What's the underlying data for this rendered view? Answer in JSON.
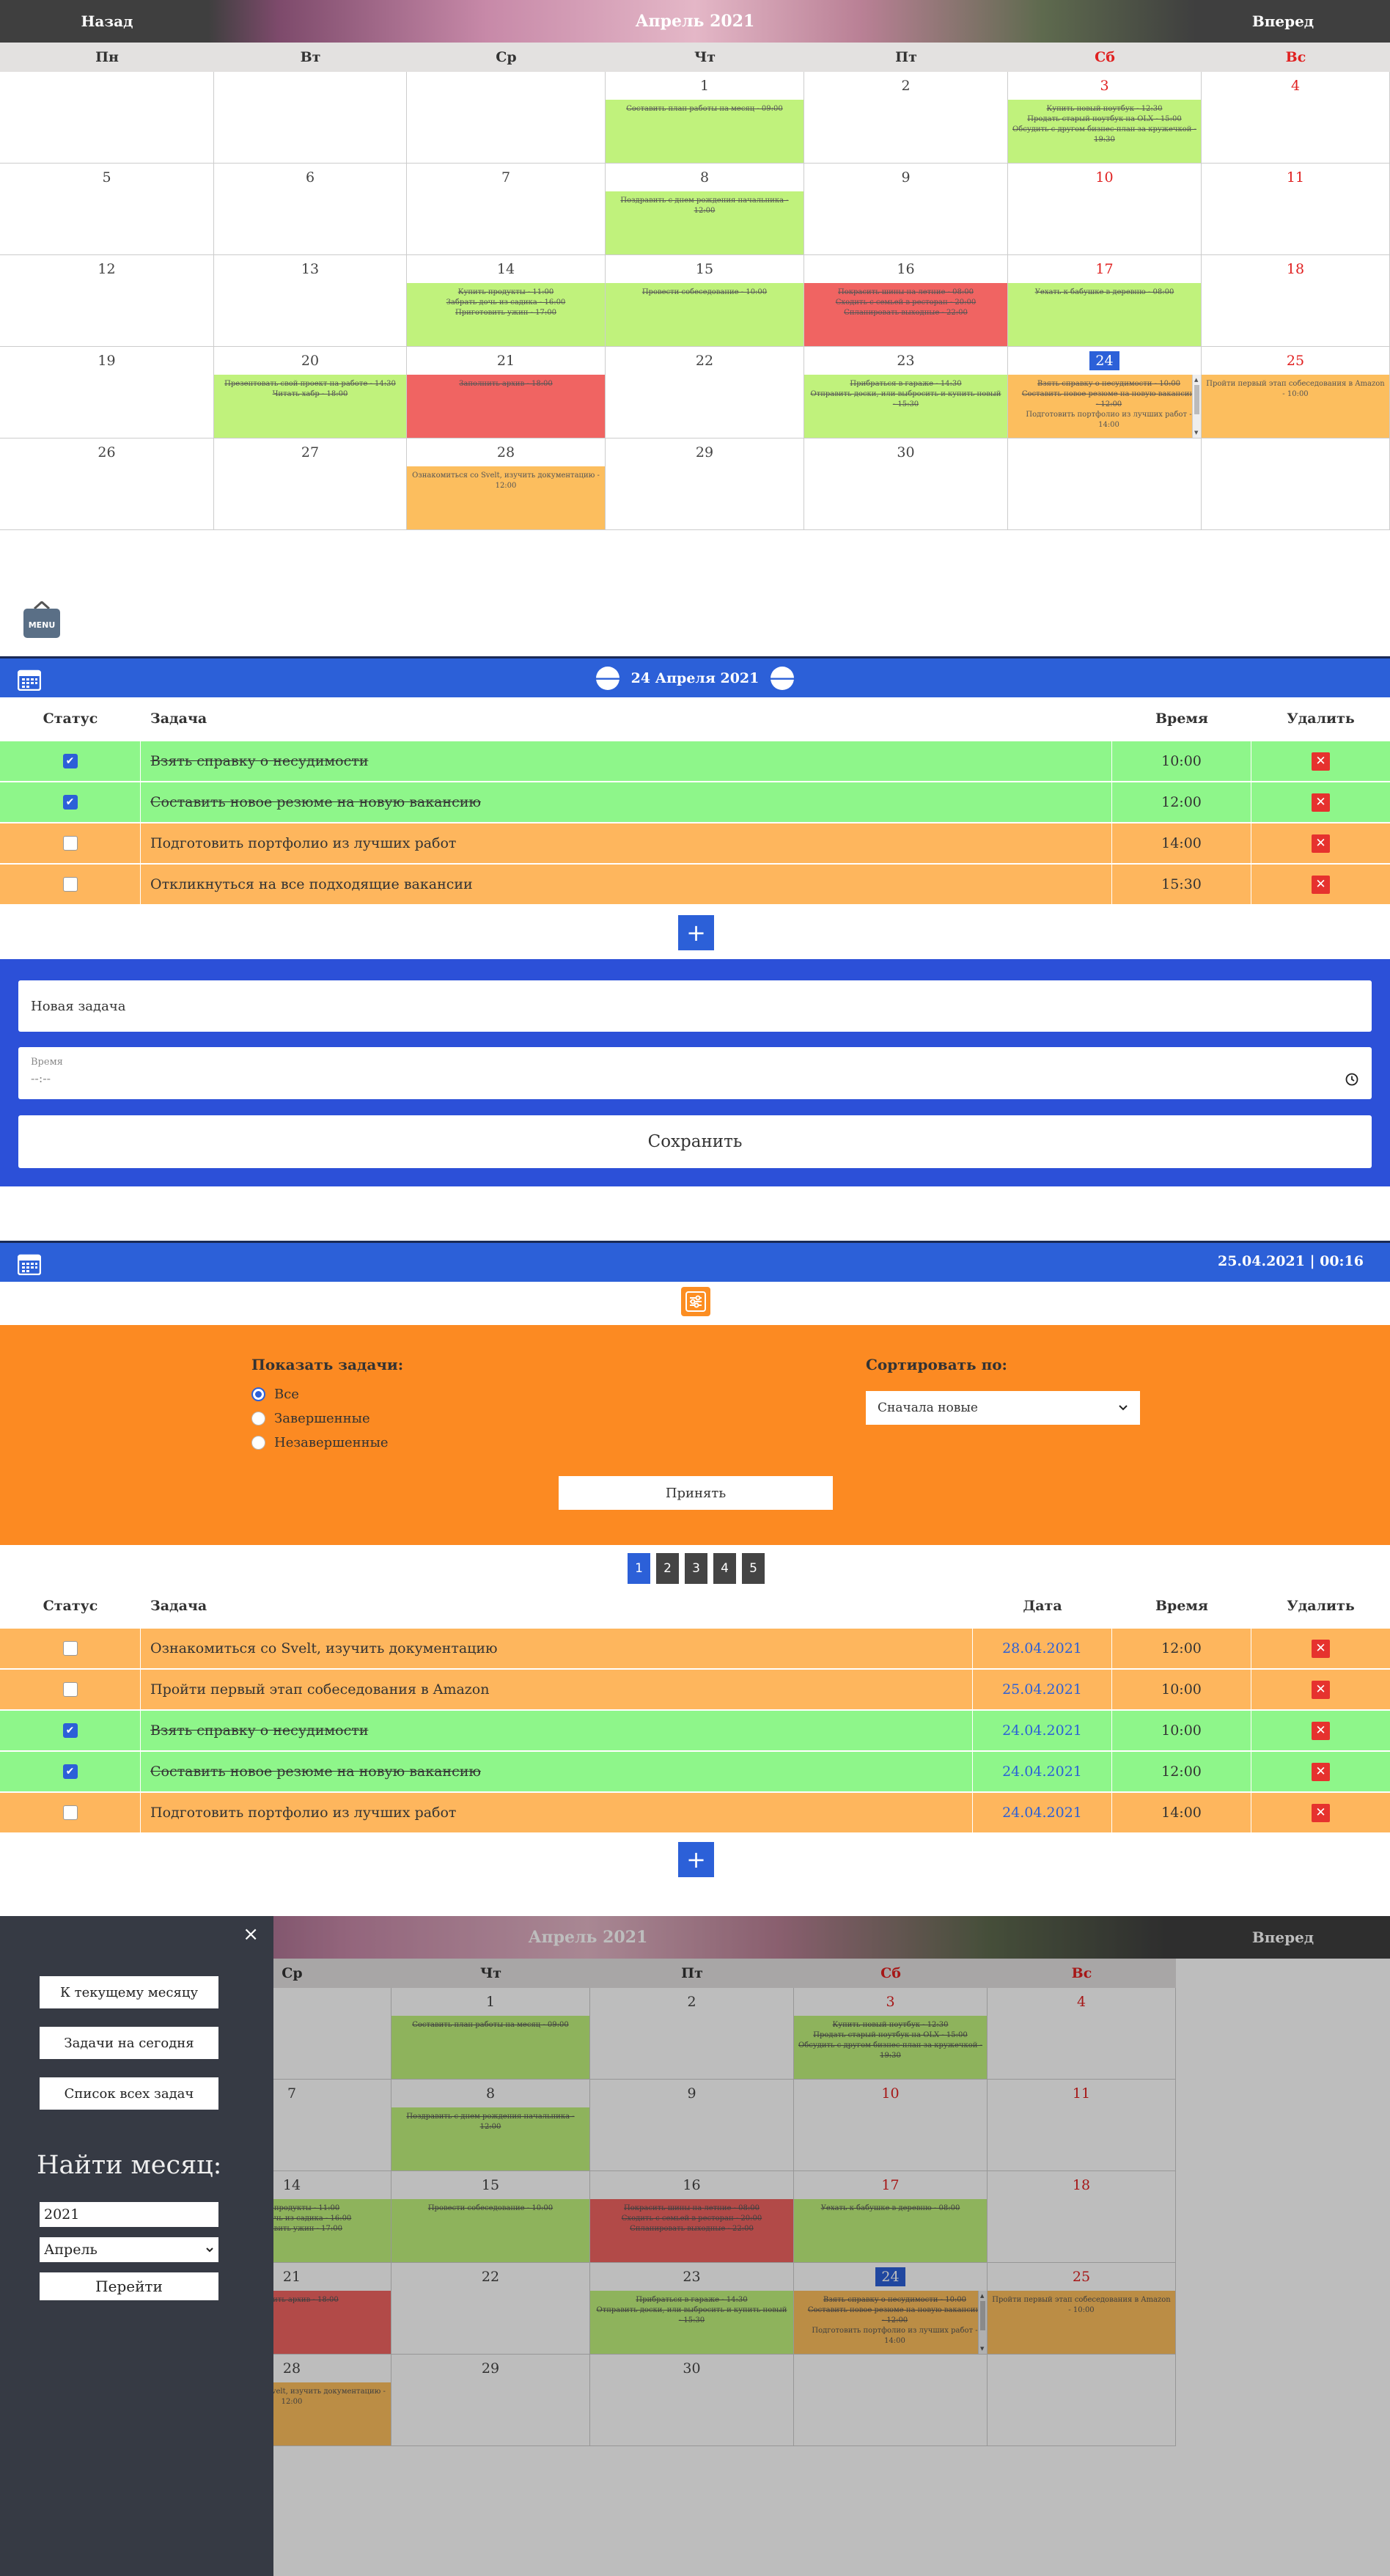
{
  "calendar": {
    "prev": "Назад",
    "title": "Апрель 2021",
    "next": "Вперед",
    "weekdays": [
      "Пн",
      "Вт",
      "Ср",
      "Чт",
      "Пт",
      "Сб",
      "Вс"
    ],
    "weeks": [
      [
        {
          "day": "",
          "events": []
        },
        {
          "day": "",
          "events": []
        },
        {
          "day": "",
          "events": []
        },
        {
          "day": "1",
          "color": "green",
          "events": [
            "Составить план работы на месяц - 09:00"
          ]
        },
        {
          "day": "2",
          "events": []
        },
        {
          "day": "3",
          "weekend": true,
          "color": "green",
          "events": [
            "Купить новый ноутбук - 12:30",
            "Продать старый ноутбук на OLX - 15:00",
            "Обсудить с другом бизнес-план за кружечкой - 19:30"
          ]
        },
        {
          "day": "4",
          "weekend": true,
          "events": []
        }
      ],
      [
        {
          "day": "5",
          "events": []
        },
        {
          "day": "6",
          "events": []
        },
        {
          "day": "7",
          "events": []
        },
        {
          "day": "8",
          "color": "green",
          "events": [
            "Поздравить с днем рождения начальника - 12:00"
          ]
        },
        {
          "day": "9",
          "events": []
        },
        {
          "day": "10",
          "weekend": true,
          "events": []
        },
        {
          "day": "11",
          "weekend": true,
          "events": []
        }
      ],
      [
        {
          "day": "12",
          "events": []
        },
        {
          "day": "13",
          "events": []
        },
        {
          "day": "14",
          "color": "green",
          "events": [
            "Купить продукты - 11:00",
            "Забрать дочь из садика - 16:00",
            "Приготовить ужин - 17:00"
          ]
        },
        {
          "day": "15",
          "color": "green",
          "events": [
            "Провести собеседование - 10:00"
          ]
        },
        {
          "day": "16",
          "color": "red",
          "events": [
            "Покрасить шины на летние - 08:00",
            "Сходить с семьей в ресторан - 20:00",
            "Спланировать выходные - 22:00"
          ]
        },
        {
          "day": "17",
          "weekend": true,
          "color": "green",
          "events": [
            "Уехать к бабушке в деревню - 08:00"
          ]
        },
        {
          "day": "18",
          "weekend": true,
          "events": []
        }
      ],
      [
        {
          "day": "19",
          "events": []
        },
        {
          "day": "20",
          "color": "green",
          "events": [
            "Презентовать свой проект на работе - 14:30",
            "Читать хабр - 18:00"
          ]
        },
        {
          "day": "21",
          "color": "red",
          "events": [
            "Заполнить архив - 18:00"
          ]
        },
        {
          "day": "22",
          "events": []
        },
        {
          "day": "23",
          "color": "green",
          "events": [
            "Прибраться в гараже - 14:30",
            "Отправить доски, или выбросить и купить новый - 15:30"
          ]
        },
        {
          "day": "24",
          "weekend": true,
          "today": true,
          "color": "orange",
          "scroll": true,
          "events": [
            "Взять справку о несудимости - 10:00",
            "Составить новое резюме на новую вакансию - 12:00",
            "Подготовить портфолио из лучших работ - 14:00"
          ]
        },
        {
          "day": "25",
          "weekend": true,
          "color": "orange",
          "events": [
            "Пройти первый этап собеседования в Amazon - 10:00"
          ]
        }
      ],
      [
        {
          "day": "26",
          "events": []
        },
        {
          "day": "27",
          "events": []
        },
        {
          "day": "28",
          "color": "orange",
          "events": [
            "Ознакомиться со Svelt, изучить документацию - 12:00"
          ]
        },
        {
          "day": "29",
          "events": []
        },
        {
          "day": "30",
          "events": []
        },
        {
          "day": "",
          "events": []
        },
        {
          "day": "",
          "events": []
        }
      ]
    ]
  },
  "menu_icon_label": "MENU",
  "day_view": {
    "date_title": "24 Апреля 2021",
    "headers": {
      "status": "Статус",
      "task": "Задача",
      "time": "Время",
      "delete": "Удалить"
    },
    "tasks": [
      {
        "title": "Взять справку о несудимости",
        "time": "10:00",
        "done": true
      },
      {
        "title": "Составить новое резюме на новую вакансию",
        "time": "12:00",
        "done": true
      },
      {
        "title": "Подготовить портфолио из лучших работ",
        "time": "14:00",
        "done": false
      },
      {
        "title": "Откликнуться на все подходящие вакансии",
        "time": "15:30",
        "done": false
      }
    ],
    "add_label": "+",
    "form": {
      "task_placeholder": "Новая задача",
      "time_label": "Время",
      "time_value": "--:--",
      "save_label": "Сохранить"
    }
  },
  "list_view": {
    "datetime": "25.04.2021 | 00:16",
    "filters": {
      "show_label": "Показать задачи:",
      "options": [
        "Все",
        "Завершенные",
        "Незавершенные"
      ],
      "selected": 0,
      "sort_label": "Сортировать по:",
      "sort_value": "Сначала новые",
      "apply_label": "Принять"
    },
    "pages": [
      "1",
      "2",
      "3",
      "4",
      "5"
    ],
    "current_page": 0,
    "headers": {
      "status": "Статус",
      "task": "Задача",
      "date": "Дата",
      "time": "Время",
      "delete": "Удалить"
    },
    "tasks": [
      {
        "title": "Ознакомиться со Svelt, изучить документацию",
        "date": "28.04.2021",
        "time": "12:00",
        "done": false
      },
      {
        "title": "Пройти первый этап собеседования в Amazon",
        "date": "25.04.2021",
        "time": "10:00",
        "done": false
      },
      {
        "title": "Взять справку о несудимости",
        "date": "24.04.2021",
        "time": "10:00",
        "done": true
      },
      {
        "title": "Составить новое резюме на новую вакансию",
        "date": "24.04.2021",
        "time": "12:00",
        "done": true
      },
      {
        "title": "Подготовить портфолио из лучших работ",
        "date": "24.04.2021",
        "time": "14:00",
        "done": false
      }
    ],
    "add_label": "+"
  },
  "sidebar": {
    "close": "×",
    "buttons": [
      "К текущему месяцу",
      "Задачи на сегодня",
      "Список всех задач"
    ],
    "find_title": "Найти месяц:",
    "year_value": "2021",
    "month_value": "Апрель",
    "go_label": "Перейти",
    "next_partial": "Впе"
  },
  "colors": {
    "blue": "#2c60d8",
    "green": "#8ef68a",
    "orange": "#feb65d",
    "red": "#e6322e",
    "accent_orange": "#fc8a22",
    "sidebar": "#363a44"
  }
}
